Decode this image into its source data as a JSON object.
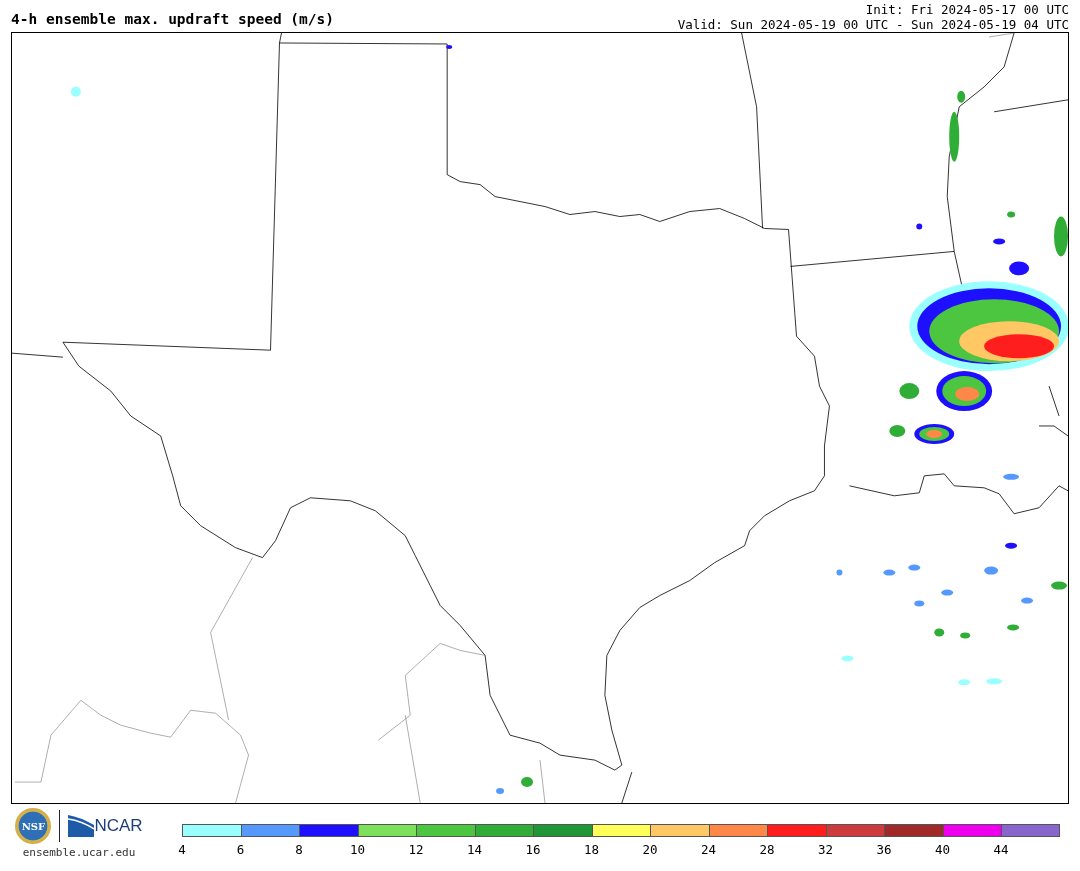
{
  "title": "4-h ensemble max. updraft speed (m/s)",
  "init": "Init: Fri 2024-05-17 00 UTC",
  "valid": "Valid: Sun 2024-05-19 00 UTC - Sun 2024-05-19 04 UTC",
  "logos": [
    {
      "kind": "nsf",
      "text": "NSF"
    },
    {
      "kind": "ncar",
      "text": "NCAR"
    }
  ],
  "site": "ensemble.ucar.edu",
  "colorbar": {
    "bins": [
      {
        "color": "#99ffff"
      },
      {
        "color": "#5599ff"
      },
      {
        "color": "#1e10ff"
      },
      {
        "color": "#7ce05a"
      },
      {
        "color": "#4cc640"
      },
      {
        "color": "#30ad36"
      },
      {
        "color": "#209638"
      },
      {
        "color": "#ffff5a"
      },
      {
        "color": "#ffc864"
      },
      {
        "color": "#ff8848"
      },
      {
        "color": "#ff1e1e"
      },
      {
        "color": "#cc3c3c"
      },
      {
        "color": "#a02a2a"
      },
      {
        "color": "#ee00ee"
      },
      {
        "color": "#8866cc"
      }
    ],
    "ticks": [
      "4",
      "6",
      "8",
      "10",
      "12",
      "14",
      "16",
      "18",
      "20",
      "24",
      "28",
      "32",
      "36",
      "40",
      "44"
    ]
  }
}
